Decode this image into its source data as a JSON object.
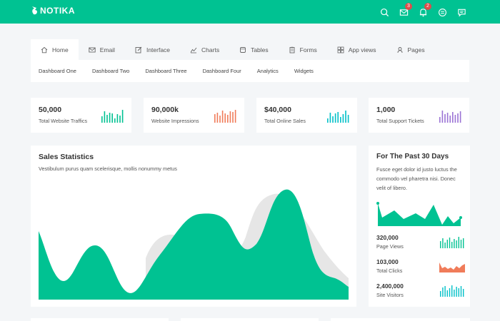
{
  "brand": {
    "name": "NOTIKA"
  },
  "header": {
    "icons": [
      {
        "name": "search-icon"
      },
      {
        "name": "mail-icon",
        "badge": "3"
      },
      {
        "name": "bell-icon",
        "badge": "2"
      },
      {
        "name": "tasks-icon"
      },
      {
        "name": "chat-icon"
      }
    ]
  },
  "nav": {
    "tabs": [
      {
        "label": "Home",
        "icon": "home-icon"
      },
      {
        "label": "Email",
        "icon": "email-icon"
      },
      {
        "label": "Interface",
        "icon": "edit-icon"
      },
      {
        "label": "Charts",
        "icon": "chart-icon"
      },
      {
        "label": "Tables",
        "icon": "table-icon"
      },
      {
        "label": "Forms",
        "icon": "form-icon"
      },
      {
        "label": "App views",
        "icon": "app-icon"
      },
      {
        "label": "Pages",
        "icon": "pages-icon"
      }
    ],
    "subitems": [
      "Dashboard One",
      "Dashboard Two",
      "Dashboard Three",
      "Dashboard Four",
      "Analytics",
      "Widgets"
    ]
  },
  "stats": [
    {
      "value": "50,000",
      "label": "Total Website Traffics",
      "color": "#00c292"
    },
    {
      "value": "90,000k",
      "label": "Website Impressions",
      "color": "#f07c5a"
    },
    {
      "value": "$40,000",
      "label": "Total Online Sales",
      "color": "#00c0c8"
    },
    {
      "value": "1,000",
      "label": "Total Support Tickets",
      "color": "#9b73d5"
    }
  ],
  "sales": {
    "title": "Sales Statistics",
    "subtitle": "Vestibulum purus quam scelerisque, mollis nonummy metus"
  },
  "past30": {
    "title": "For The Past 30 Days",
    "description": "Fusce eget dolor id justo luctus the commodo vel pharetra nisi. Donec velit of libero.",
    "kpis": [
      {
        "value": "320,000",
        "label": "Page Views",
        "color": "#00c292"
      },
      {
        "value": "103,000",
        "label": "Total Clicks",
        "color": "#f07c5a"
      },
      {
        "value": "2,400,000",
        "label": "Site Visitors",
        "color": "#00c0c8"
      }
    ]
  },
  "colors": {
    "accent": "#00c292",
    "secondary": "#e6e6e6"
  }
}
